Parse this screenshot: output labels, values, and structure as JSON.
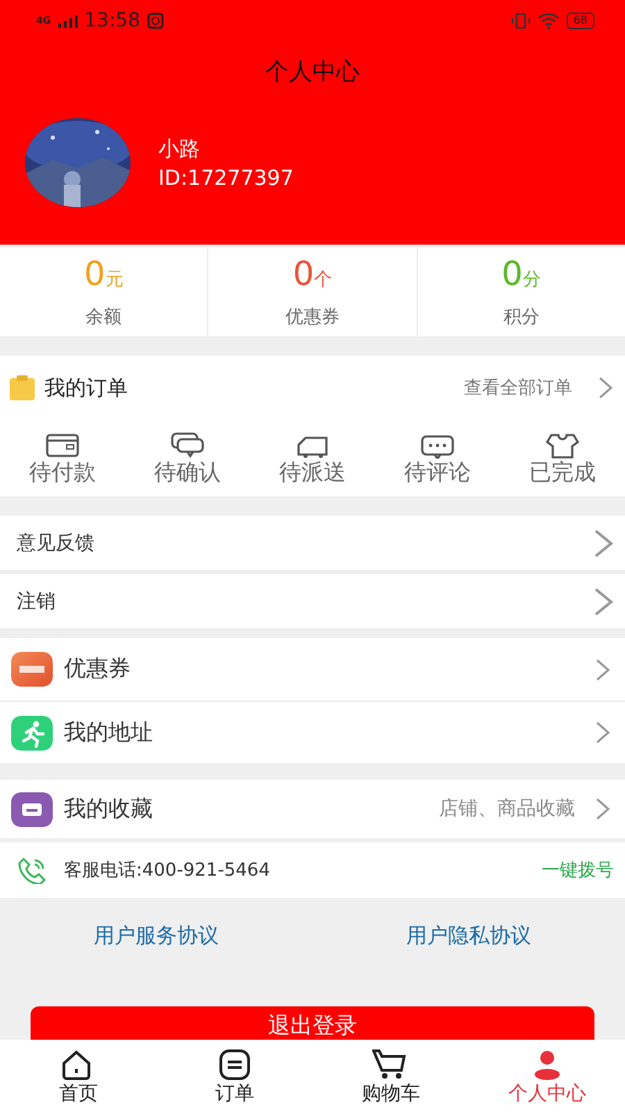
{
  "status_bar": {
    "network": "4G",
    "time": "13:58",
    "battery": "68"
  },
  "header": {
    "title": "个人中心"
  },
  "profile": {
    "name": "小路",
    "id": "ID:17277397"
  },
  "stats": [
    {
      "value": "0",
      "unit": "元",
      "label": "余额",
      "color": "#f0a020"
    },
    {
      "value": "0",
      "unit": "个",
      "label": "优惠券",
      "color": "#e8553a"
    },
    {
      "value": "0",
      "unit": "分",
      "label": "积分",
      "color": "#5ab82a"
    }
  ],
  "orders": {
    "title": "我的订单",
    "link": "查看全部订单",
    "statuses": [
      {
        "kind": "wallet",
        "label": "待付款"
      },
      {
        "kind": "chat",
        "label": "待确认"
      },
      {
        "kind": "truck",
        "label": "待派送"
      },
      {
        "kind": "comment",
        "label": "待评论"
      },
      {
        "kind": "shirt",
        "label": "已完成"
      }
    ]
  },
  "settings": [
    {
      "label": "意见反馈"
    },
    {
      "label": "注销"
    }
  ],
  "menu": [
    {
      "kind": "coupon",
      "label": "优惠券"
    },
    {
      "kind": "runner",
      "label": "我的地址"
    }
  ],
  "favorites": {
    "label": "我的收藏",
    "hint": "店铺、商品收藏"
  },
  "service": {
    "label": "客服电话:400-921-5464",
    "action": "一键拨号"
  },
  "agreements": [
    "用户服务协议",
    "用户隐私协议"
  ],
  "logout": "退出登录",
  "tabs": [
    {
      "kind": "home",
      "label": "首页",
      "selected": false
    },
    {
      "kind": "orders",
      "label": "订单",
      "selected": false
    },
    {
      "kind": "cart",
      "label": "购物车",
      "selected": false
    },
    {
      "kind": "person",
      "label": "个人中心",
      "selected": true
    }
  ]
}
